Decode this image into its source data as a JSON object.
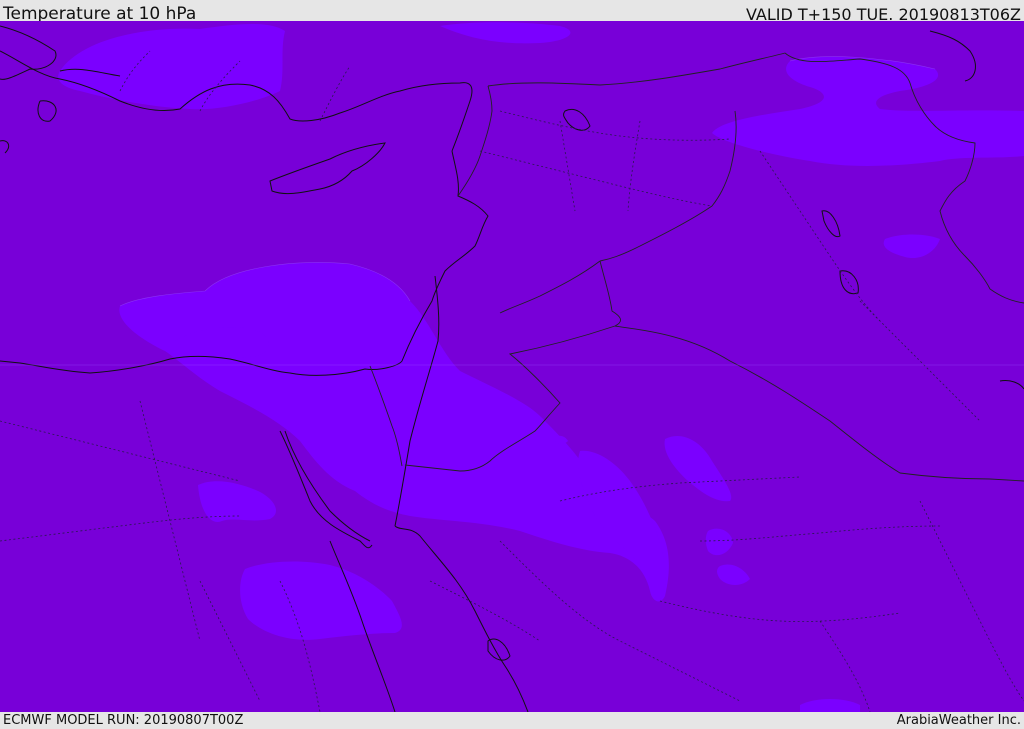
{
  "header": {
    "title": "Temperature at 10 hPa",
    "valid_time": "VALID T+150 TUE. 20190813T06Z"
  },
  "footer": {
    "model_run": "ECMWF MODEL RUN: 20190807T00Z",
    "credit": "ArabiaWeather Inc."
  },
  "colors": {
    "background_field": "#7800d8",
    "warmer_band": "#7b00ff",
    "coastline": "#111111",
    "header_bg": "#e6e6e6"
  }
}
